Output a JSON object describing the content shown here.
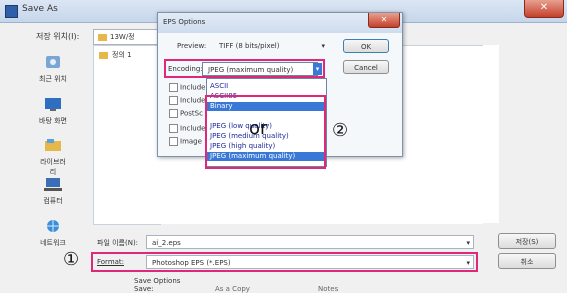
{
  "window": {
    "title": "Save As",
    "close_glyph": "✕"
  },
  "top_bar": {
    "location_label": "저장 위치(I):",
    "current_folder": "13W/정",
    "folder_item": "정의 1"
  },
  "nav_items": [
    {
      "label": "최근 위치",
      "icon": "recent-places-icon"
    },
    {
      "label": "바탕 화면",
      "icon": "desktop-icon"
    },
    {
      "label": "라이브러리",
      "icon": "libraries-icon"
    },
    {
      "label": "컴퓨터",
      "icon": "computer-icon"
    },
    {
      "label": "네트워크",
      "icon": "network-icon"
    }
  ],
  "bottom": {
    "filename_label": "파일 이름(N):",
    "filename_value": "ai_2.eps",
    "format_label": "Format:",
    "format_value": "Photoshop EPS (*.EPS)",
    "save_button": "저장(S)",
    "cancel_button": "취소",
    "save_options_label": "Save Options",
    "save_label": "Save:",
    "as_a_copy": "As a Copy",
    "notes": "Notes"
  },
  "eps_dialog": {
    "title": "EPS Options",
    "preview_label": "Preview:",
    "preview_value": "TIFF (8 bits/pixel)",
    "encoding_label": "Encoding:",
    "encoding_value": "JPEG (maximum quality)",
    "ok_button": "OK",
    "cancel_button": "Cancel",
    "checkboxes": [
      "Include",
      "Include",
      "PostSc",
      "Include",
      "Image"
    ],
    "encoding_options": [
      {
        "label": "ASCII",
        "selected": false
      },
      {
        "label": "ASCII85",
        "selected": false
      },
      {
        "label": "Binary",
        "selected": true
      },
      {
        "label": "JPEG (low quality)",
        "selected": false
      },
      {
        "label": "JPEG (medium quality)",
        "selected": false
      },
      {
        "label": "JPEG (high quality)",
        "selected": false
      },
      {
        "label": "JPEG (maximum quality)",
        "selected": true
      }
    ]
  },
  "annotations": {
    "marker_1": "①",
    "marker_2": "②",
    "or_text": "or",
    "highlight_color": "#e0287a"
  }
}
